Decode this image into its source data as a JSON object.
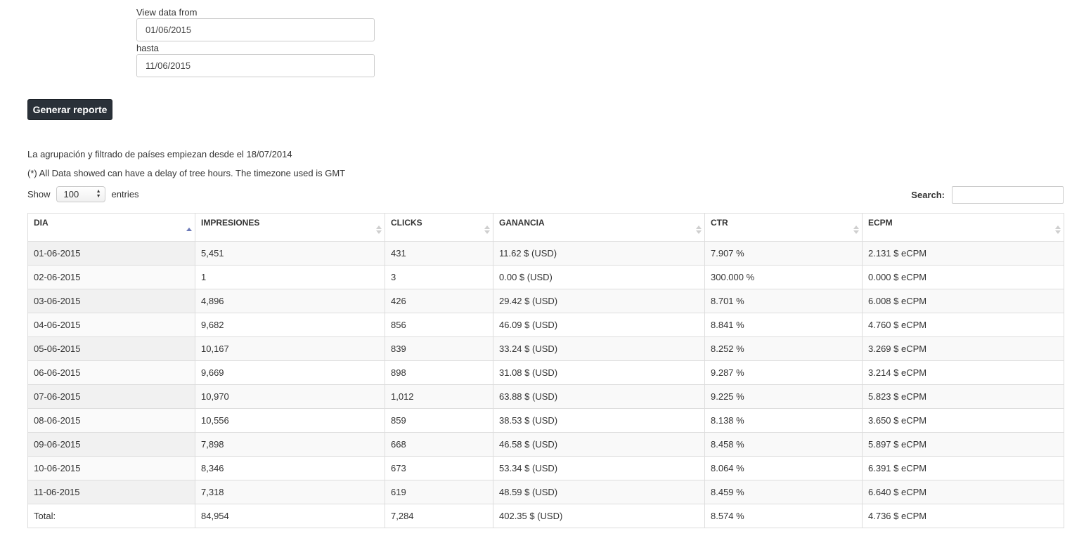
{
  "filters": {
    "from_label": "View data from",
    "from_value": "01/06/2015",
    "to_label": "hasta",
    "to_value": "11/06/2015",
    "generate_label": "Generar reporte"
  },
  "notes": {
    "grouping": "La agrupación y filtrado de países empiezan desde el 18/07/2014",
    "delay": "(*) All Data showed can have a delay of tree hours. The timezone used is GMT"
  },
  "table_controls": {
    "show_label": "Show",
    "entries_value": "100",
    "entries_label": "entries",
    "search_label": "Search:"
  },
  "table": {
    "columns": [
      "DIA",
      "IMPRESIONES",
      "CLICKS",
      "GANANCIA",
      "CTR",
      "ECPM"
    ],
    "sorted_column": "DIA",
    "sort_direction": "ascending",
    "rows": [
      [
        "01-06-2015",
        "5,451",
        "431",
        "11.62 $ (USD)",
        "7.907 %",
        "2.131 $ eCPM"
      ],
      [
        "02-06-2015",
        "1",
        "3",
        "0.00 $ (USD)",
        "300.000 %",
        "0.000 $ eCPM"
      ],
      [
        "03-06-2015",
        "4,896",
        "426",
        "29.42 $ (USD)",
        "8.701 %",
        "6.008 $ eCPM"
      ],
      [
        "04-06-2015",
        "9,682",
        "856",
        "46.09 $ (USD)",
        "8.841 %",
        "4.760 $ eCPM"
      ],
      [
        "05-06-2015",
        "10,167",
        "839",
        "33.24 $ (USD)",
        "8.252 %",
        "3.269 $ eCPM"
      ],
      [
        "06-06-2015",
        "9,669",
        "898",
        "31.08 $ (USD)",
        "9.287 %",
        "3.214 $ eCPM"
      ],
      [
        "07-06-2015",
        "10,970",
        "1,012",
        "63.88 $ (USD)",
        "9.225 %",
        "5.823 $ eCPM"
      ],
      [
        "08-06-2015",
        "10,556",
        "859",
        "38.53 $ (USD)",
        "8.138 %",
        "3.650 $ eCPM"
      ],
      [
        "09-06-2015",
        "7,898",
        "668",
        "46.58 $ (USD)",
        "8.458 %",
        "5.897 $ eCPM"
      ],
      [
        "10-06-2015",
        "8,346",
        "673",
        "53.34 $ (USD)",
        "8.064 %",
        "6.391 $ eCPM"
      ],
      [
        "11-06-2015",
        "7,318",
        "619",
        "48.59 $ (USD)",
        "8.459 %",
        "6.640 $ eCPM"
      ]
    ],
    "total": [
      "Total:",
      "84,954",
      "7,284",
      "402.35 $ (USD)",
      "8.574 %",
      "4.736 $ eCPM"
    ]
  }
}
